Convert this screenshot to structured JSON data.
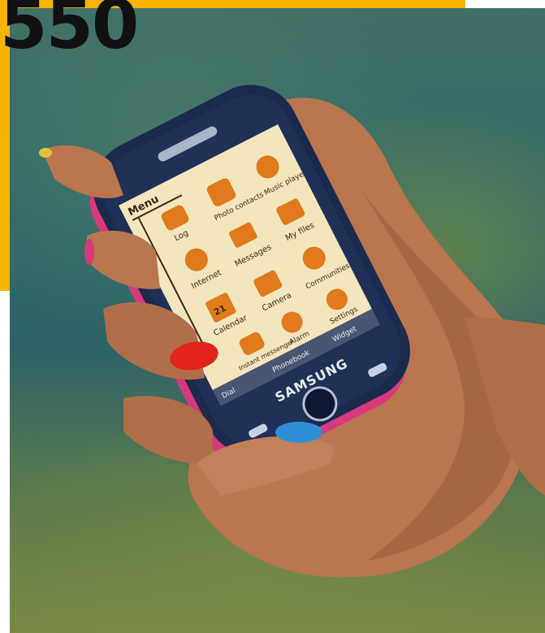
{
  "model_number": "550",
  "phone": {
    "brand": "SAMSUNG",
    "screen": {
      "title": "Menu",
      "apps": [
        {
          "label": "Log",
          "icon": "log-icon"
        },
        {
          "label": "Photo contacts",
          "icon": "photo-contacts-icon"
        },
        {
          "label": "Music player",
          "icon": "music-player-icon"
        },
        {
          "label": "Internet",
          "icon": "internet-icon"
        },
        {
          "label": "Messages",
          "icon": "messages-icon"
        },
        {
          "label": "My files",
          "icon": "my-files-icon"
        },
        {
          "label": "Calendar",
          "icon": "calendar-icon"
        },
        {
          "label": "Camera",
          "icon": "camera-icon"
        },
        {
          "label": "Communities",
          "icon": "communities-icon"
        },
        {
          "label": "Instant messenger",
          "icon": "instant-messenger-icon"
        },
        {
          "label": "Alarm",
          "icon": "alarm-icon"
        },
        {
          "label": "Settings",
          "icon": "settings-icon"
        }
      ],
      "calendar_day": "21",
      "bottom_tabs": [
        "Dial",
        "Phonebook",
        "Widget"
      ]
    }
  },
  "colors": {
    "accent_yellow": "#f7b500",
    "phone_body": "#1c2a4d",
    "screen_bg": "#f3e6bd",
    "icon_orange": "#e07a1c",
    "nail_red": "#e3241b",
    "nail_blue": "#2f8fd6",
    "nail_pink": "#d63a7c",
    "background_teal": "#2f6a68"
  }
}
